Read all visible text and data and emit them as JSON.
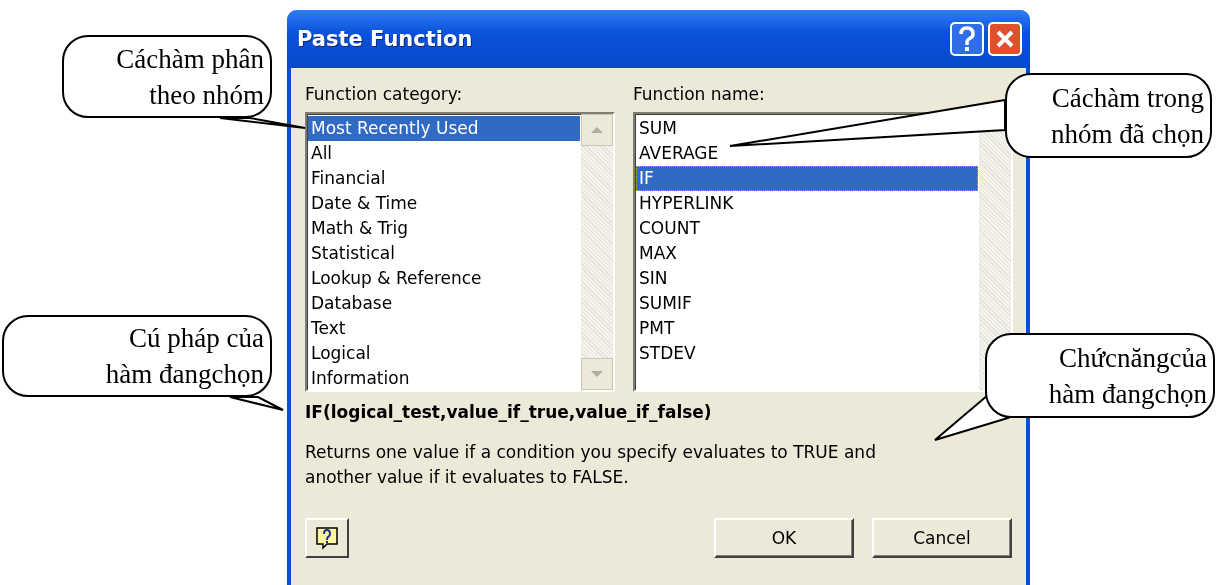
{
  "window": {
    "title": "Paste Function"
  },
  "category": {
    "label": "Function category:",
    "items": [
      {
        "label": "Most Recently Used",
        "selected": true
      },
      {
        "label": "All",
        "selected": false
      },
      {
        "label": "Financial",
        "selected": false
      },
      {
        "label": "Date & Time",
        "selected": false
      },
      {
        "label": "Math & Trig",
        "selected": false
      },
      {
        "label": "Statistical",
        "selected": false
      },
      {
        "label": "Lookup & Reference",
        "selected": false
      },
      {
        "label": "Database",
        "selected": false
      },
      {
        "label": "Text",
        "selected": false
      },
      {
        "label": "Logical",
        "selected": false
      },
      {
        "label": "Information",
        "selected": false
      }
    ]
  },
  "function_name": {
    "label": "Function name:",
    "items": [
      {
        "label": "SUM",
        "selected": false
      },
      {
        "label": "AVERAGE",
        "selected": false
      },
      {
        "label": "IF",
        "selected": true
      },
      {
        "label": "HYPERLINK",
        "selected": false
      },
      {
        "label": "COUNT",
        "selected": false
      },
      {
        "label": "MAX",
        "selected": false
      },
      {
        "label": "SIN",
        "selected": false
      },
      {
        "label": "SUMIF",
        "selected": false
      },
      {
        "label": "PMT",
        "selected": false
      },
      {
        "label": "STDEV",
        "selected": false
      }
    ]
  },
  "syntax": "IF(logical_test,value_if_true,value_if_false)",
  "description": "Returns one value if a condition you specify evaluates to TRUE and another value if it evaluates to FALSE.",
  "buttons": [
    "OK",
    "Cancel"
  ],
  "callouts": [
    {
      "text": "Cáchàm phân\ntheo nhóm"
    },
    {
      "text": "Cáchàm trong\nnhóm đã chọn"
    },
    {
      "text": "Cú pháp của\nhàm đangchọn"
    },
    {
      "text": "Chứcnăngcủa\nhàm đangchọn"
    }
  ]
}
